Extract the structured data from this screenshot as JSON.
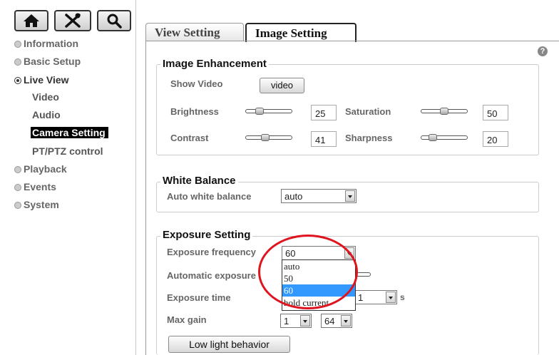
{
  "colors": {
    "accent_red": "#e0141e",
    "selected_option": "#3399ff",
    "active_nav_bg": "#000000"
  },
  "toolbar": {
    "home_icon": "home-icon",
    "tools_icon": "tools-icon",
    "search_icon": "search-icon"
  },
  "sidebar": {
    "items": [
      {
        "label": "Information"
      },
      {
        "label": "Basic Setup"
      },
      {
        "label": "Live View"
      },
      {
        "label": "Playback"
      },
      {
        "label": "Events"
      },
      {
        "label": "System"
      }
    ],
    "live_view_children": [
      {
        "label": "Video"
      },
      {
        "label": "Audio"
      },
      {
        "label": "Camera Setting"
      },
      {
        "label": "PT/PTZ control"
      }
    ]
  },
  "tabs": [
    {
      "label": "View Setting"
    },
    {
      "label": "Image Setting"
    }
  ],
  "help_label": "?",
  "image_enhancement": {
    "title": "Image Enhancement",
    "show_video_label": "Show Video",
    "video_button": "video",
    "brightness": {
      "label": "Brightness",
      "value": "25",
      "level": 0.25
    },
    "saturation": {
      "label": "Saturation",
      "value": "50",
      "level": 0.5
    },
    "contrast": {
      "label": "Contrast",
      "value": "41",
      "level": 0.41
    },
    "sharpness": {
      "label": "Sharpness",
      "value": "20",
      "level": 0.2
    }
  },
  "white_balance": {
    "title": "White Balance",
    "auto_label": "Auto white balance",
    "auto_value": "auto"
  },
  "exposure": {
    "title": "Exposure Setting",
    "frequency_label": "Exposure frequency",
    "frequency_value": "60",
    "frequency_options": [
      "auto",
      "50",
      "60",
      "hold current"
    ],
    "automatic_label": "Automatic exposure",
    "time_label": "Exposure time",
    "time_value": "1",
    "time_unit": "s",
    "max_gain_label": "Max gain",
    "max_gain_min": "1",
    "max_gain_max": "64",
    "low_light_button": "Low light behavior"
  }
}
